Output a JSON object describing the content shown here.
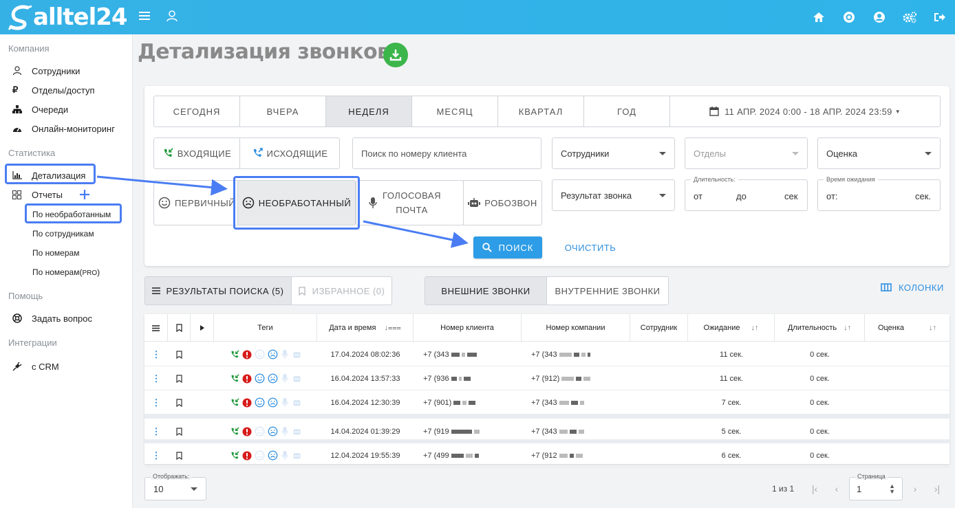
{
  "app": {
    "logo_text": "alltel24"
  },
  "topbar": {
    "icons": [
      "home-icon",
      "record-icon",
      "profile-icon",
      "settings-icon",
      "logout-icon"
    ]
  },
  "sidebar": {
    "section_company": "Компания",
    "employees": "Сотрудники",
    "departments": "Отделы/доступ",
    "queues": "Очереди",
    "monitoring": "Онлайн-мониторинг",
    "section_stats": "Статистика",
    "details": "Детализация",
    "reports": "Отчеты",
    "sub_unprocessed": "По необработанным",
    "sub_employees": "По сотрудникам",
    "sub_numbers": "По номерам",
    "sub_numbers_pro_a": "По номерам(",
    "sub_numbers_pro_b": "PRO",
    "sub_numbers_pro_c": ")",
    "section_help": "Помощь",
    "ask": "Задать вопрос",
    "section_integrations": "Интеграции",
    "crm": "с CRM"
  },
  "page": {
    "title": "Детализация звонков"
  },
  "filters": {
    "periods": [
      "СЕГОДНЯ",
      "ВЧЕРА",
      "НЕДЕЛЯ",
      "МЕСЯЦ",
      "КВАРТАЛ",
      "ГОД"
    ],
    "active_period": "НЕДЕЛЯ",
    "date_range": "11 АПР. 2024 0:00 - 18 АПР. 2024 23:59",
    "incoming": "ВХОДЯЩИЕ",
    "outgoing": "ИСХОДЯЩИЕ",
    "search_placeholder": "Поиск по номеру клиента",
    "employees": "Сотрудники",
    "departments": "Отделы",
    "rating": "Оценка",
    "primary": "ПЕРВИЧНЫЙ",
    "unprocessed": "НЕОБРАБОТАННЫЙ",
    "voicemail_1": "ГОЛОСОВАЯ",
    "voicemail_2": "ПОЧТА",
    "robocall": "РОБОЗВОН",
    "call_result": "Результат звонка",
    "duration_legend": "Длительность:",
    "dur_from": "от",
    "dur_to": "до",
    "dur_unit": "сек",
    "wait_legend": "Время ожидания",
    "wait_from": "от:",
    "wait_unit": "сек.",
    "search_btn": "ПОИСК",
    "clear_btn": "ОЧИСТИТЬ"
  },
  "tabs": {
    "results": "РЕЗУЛЬТАТЫ ПОИСКА (5)",
    "favorites": "ИЗБРАННОЕ (0)",
    "external": "ВНЕШНИЕ ЗВОНКИ",
    "internal": "ВНУТРЕННИЕ ЗВОНКИ",
    "columns": "КОЛОНКИ"
  },
  "table": {
    "headers": {
      "tags": "Теги",
      "datetime": "Дата и время",
      "client": "Номер клиента",
      "company": "Номер компании",
      "employee": "Сотрудник",
      "wait": "Ожидание",
      "duration": "Длительность",
      "rating": "Оценка"
    },
    "rows": [
      {
        "datetime": "17.04.2024 08:02:36",
        "client": "+7 (343",
        "company": "+7 (343",
        "wait": "11 сек.",
        "duration": "0 сек.",
        "smile_active": false
      },
      {
        "datetime": "16.04.2024 13:57:33",
        "client": "+7 (936",
        "company": "+7 (912)",
        "wait": "11 сек.",
        "duration": "0 сек.",
        "smile_active": true
      },
      {
        "datetime": "16.04.2024 12:30:39",
        "client": "+7 (901)",
        "company": "+7 (343",
        "wait": "7 сек.",
        "duration": "0 сек.",
        "smile_active": true
      },
      {
        "datetime": "14.04.2024 01:39:29",
        "client": "+7 (919",
        "company": "+7 (343",
        "wait": "5 сек.",
        "duration": "0 сек.",
        "smile_active": false
      },
      {
        "datetime": "12.04.2024 19:55:39",
        "client": "+7 (499",
        "company": "+7 (912",
        "wait": "6 сек.",
        "duration": "0 сек.",
        "smile_active": false
      }
    ]
  },
  "footer": {
    "per_page_legend": "Отображать:",
    "per_page": "10",
    "pages_info": "1 из 1",
    "page_legend": "Страница",
    "page": "1"
  },
  "colors": {
    "accent": "#2e9de7",
    "highlight": "#4a7df3",
    "topbar": "#36b1e6",
    "download": "#3cb54a",
    "incoming": "#1f9a3a",
    "alert": "#d81b1b"
  }
}
